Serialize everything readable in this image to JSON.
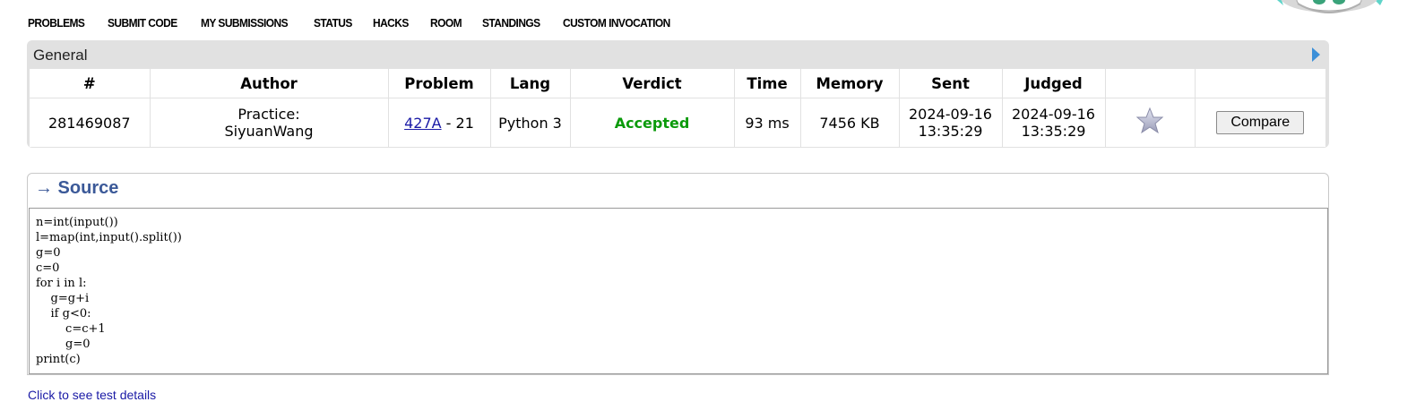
{
  "menu": [
    "PROBLEMS",
    "SUBMIT CODE",
    "MY SUBMISSIONS",
    "STATUS",
    "HACKS",
    "ROOM",
    "STANDINGS",
    "CUSTOM INVOCATION"
  ],
  "panel": {
    "title": "General"
  },
  "table": {
    "headers": [
      "#",
      "Author",
      "Problem",
      "Lang",
      "Verdict",
      "Time",
      "Memory",
      "Sent",
      "Judged",
      "",
      ""
    ],
    "row": {
      "id": "281469087",
      "author_line1": "Practice:",
      "author_line2": "SiyuanWang",
      "problem_code": "427A",
      "problem_rest": " - 21",
      "lang": "Python 3",
      "verdict": "Accepted",
      "time": "93 ms",
      "memory": "7456 KB",
      "sent_date": "2024-09-16",
      "sent_time": "13:35:29",
      "judged_date": "2024-09-16",
      "judged_time": "13:35:29",
      "compare_label": "Compare"
    }
  },
  "source": {
    "title": "→ Source",
    "code": "n=int(input())\nl=map(int,input().split())\ng=0\nc=0\nfor i in l:\n    g=g+i\n    if g<0:\n        c=c+1\n        g=0\nprint(c)"
  },
  "bottom_link": "Click to see test details",
  "colors": {
    "accepted": "#0a9a0a",
    "link": "#1a1aa6",
    "source_title": "#3b5998",
    "panel_bg": "#e1e1e1"
  },
  "icons": {
    "favourite": "star-icon",
    "panel_toggle": "triangle-right-icon"
  }
}
